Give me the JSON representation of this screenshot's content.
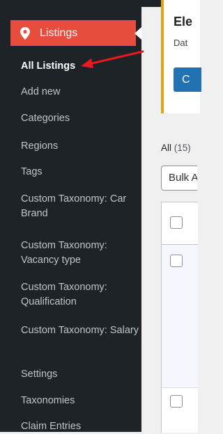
{
  "sidebar": {
    "menu_label": "Listings",
    "items": [
      {
        "label": "All Listings",
        "current": true
      },
      {
        "label": "Add new"
      },
      {
        "label": "Categories"
      },
      {
        "label": "Regions"
      },
      {
        "label": "Tags"
      },
      {
        "label": "Custom Taxonomy: Car Brand"
      },
      {
        "label": "Custom Taxonomy: Vacancy type"
      },
      {
        "label": "Custom Taxonomy: Qualification"
      },
      {
        "label": "Custom Taxonomy: Salary"
      },
      {
        "label": "Settings"
      },
      {
        "label": "Taxonomies"
      },
      {
        "label": "Claim Entries"
      }
    ]
  },
  "main": {
    "notice_title": "Ele",
    "notice_text": "Dat",
    "notice_button": "C",
    "filter_all": "All",
    "filter_all_count": "(15)",
    "bulk_actions": "Bulk A"
  },
  "colors": {
    "sidebar_bg": "#1d2327",
    "listings_active": "#e74c3c",
    "notice_border": "#dba617",
    "primary_button": "#2271b1",
    "annotation_arrow": "#e8191f"
  },
  "icons": {
    "listings": "map-pin-icon"
  }
}
